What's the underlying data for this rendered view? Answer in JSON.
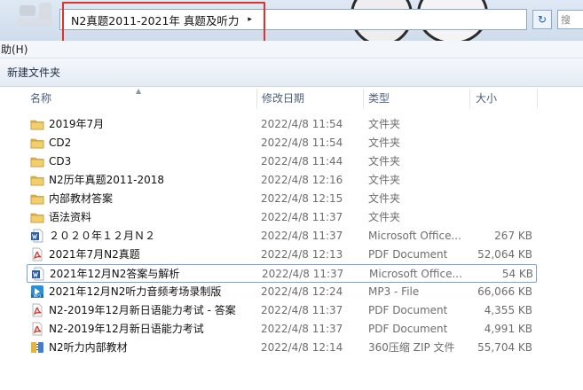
{
  "address": {
    "path": "N2真题2011-2021年 真题及听力",
    "separator": "▸",
    "refresh_glyph": "↻",
    "search_text": "搜"
  },
  "menubar": {
    "help_label": "助(H)"
  },
  "toolbar": {
    "new_folder_label": "新建文件夹"
  },
  "columns": {
    "name": "名称",
    "date": "修改日期",
    "type": "类型",
    "size": "大小"
  },
  "files": [
    {
      "icon": "folder-icon",
      "name": "2019年7月",
      "date": "2022/4/8 11:54",
      "type": "文件夹",
      "size": ""
    },
    {
      "icon": "folder-icon",
      "name": "CD2",
      "date": "2022/4/8 11:54",
      "type": "文件夹",
      "size": ""
    },
    {
      "icon": "folder-icon",
      "name": "CD3",
      "date": "2022/4/8 11:44",
      "type": "文件夹",
      "size": ""
    },
    {
      "icon": "folder-icon",
      "name": "N2历年真题2011-2018",
      "date": "2022/4/8 12:16",
      "type": "文件夹",
      "size": ""
    },
    {
      "icon": "folder-icon",
      "name": "内部教材答案",
      "date": "2022/4/8 12:15",
      "type": "文件夹",
      "size": ""
    },
    {
      "icon": "folder-icon",
      "name": "语法资料",
      "date": "2022/4/8 11:37",
      "type": "文件夹",
      "size": ""
    },
    {
      "icon": "word-icon",
      "name": "２０２０年１２月Ｎ２",
      "date": "2022/4/8 11:37",
      "type": "Microsoft Office...",
      "size": "267 KB"
    },
    {
      "icon": "pdf-icon",
      "name": "2021年7月N2真题",
      "date": "2022/4/8 12:13",
      "type": "PDF Document",
      "size": "52,064 KB"
    },
    {
      "icon": "word-icon",
      "name": "2021年12月N2答案与解析",
      "date": "2022/4/8 11:37",
      "type": "Microsoft Office...",
      "size": "54 KB"
    },
    {
      "icon": "mp3-icon",
      "name": "2021年12月N2听力音频考场录制版",
      "date": "2022/4/8 12:24",
      "type": "MP3 - File",
      "size": "66,066 KB"
    },
    {
      "icon": "pdf-icon",
      "name": "N2-2019年12月新日语能力考试 - 答案",
      "date": "2022/4/8 11:37",
      "type": "PDF Document",
      "size": "4,355 KB"
    },
    {
      "icon": "pdf-icon",
      "name": "N2-2019年12月新日语能力考试",
      "date": "2022/4/8 11:37",
      "type": "PDF Document",
      "size": "4,991 KB"
    },
    {
      "icon": "zip-icon",
      "name": "N2听力内部教材",
      "date": "2022/4/8 12:14",
      "type": "360压缩 ZIP 文件",
      "size": "55,704 KB"
    }
  ],
  "colors": {
    "highlight_box": "#e0312a",
    "folder": "#e8b84a",
    "pdf": "#d9342b",
    "word": "#2a5fa8",
    "mp3": "#2b8fd6",
    "zip": "#3f7fd0"
  }
}
